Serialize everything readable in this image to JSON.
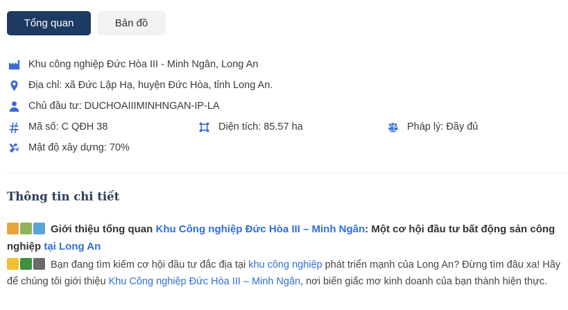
{
  "tabs": {
    "overview": "Tổng quan",
    "map": "Bản đồ"
  },
  "info": {
    "name": "Khu công nghiệp Đức Hòa III - Minh Ngân, Long An",
    "address": "Địa chỉ: xã Đức Lập Hạ, huyện Đức Hòa, tỉnh Long An.",
    "investor": "Chủ đầu tư: DUCHOAIIIMINHNGAN-IP-LA",
    "code": "Mã số: C QĐH 38",
    "area": "Diện tích: 85.57 ha",
    "legal": "Pháp lý: Đầy đủ",
    "density": "Mật độ xây dựng: 70%"
  },
  "details": {
    "title": "Thông tin chi tiết",
    "p1": {
      "intro": "Giới thiệu tổng quan",
      "link1": "Khu Công nghiệp Đức Hòa III – Minh Ngân",
      "mid": ": Một cơ hội đầu tư bất động sản công nghiệp",
      "link2": "tại Long An"
    },
    "p2": {
      "a": "Bạn đang tìm kiếm cơ hội đầu tư đắc địa tại",
      "link1": "khu công nghiệp",
      "b": "phát triển mạnh của Long An? Đừng tìm đâu xa! Hãy để chúng tôi giới thiệu",
      "link2": "Khu Công nghiệp Đức Hòa III – Minh Ngân",
      "c": ", nơi biến giấc mơ kinh doanh của bạn thành hiện thực."
    }
  },
  "colors": {
    "primary": "#1d3a63",
    "icon": "#3b6cd6",
    "link": "#2f6ed6"
  },
  "icons": [
    "factory-icon",
    "location-pin-icon",
    "user-icon",
    "hash-icon",
    "area-icon",
    "scale-icon",
    "tools-icon"
  ]
}
